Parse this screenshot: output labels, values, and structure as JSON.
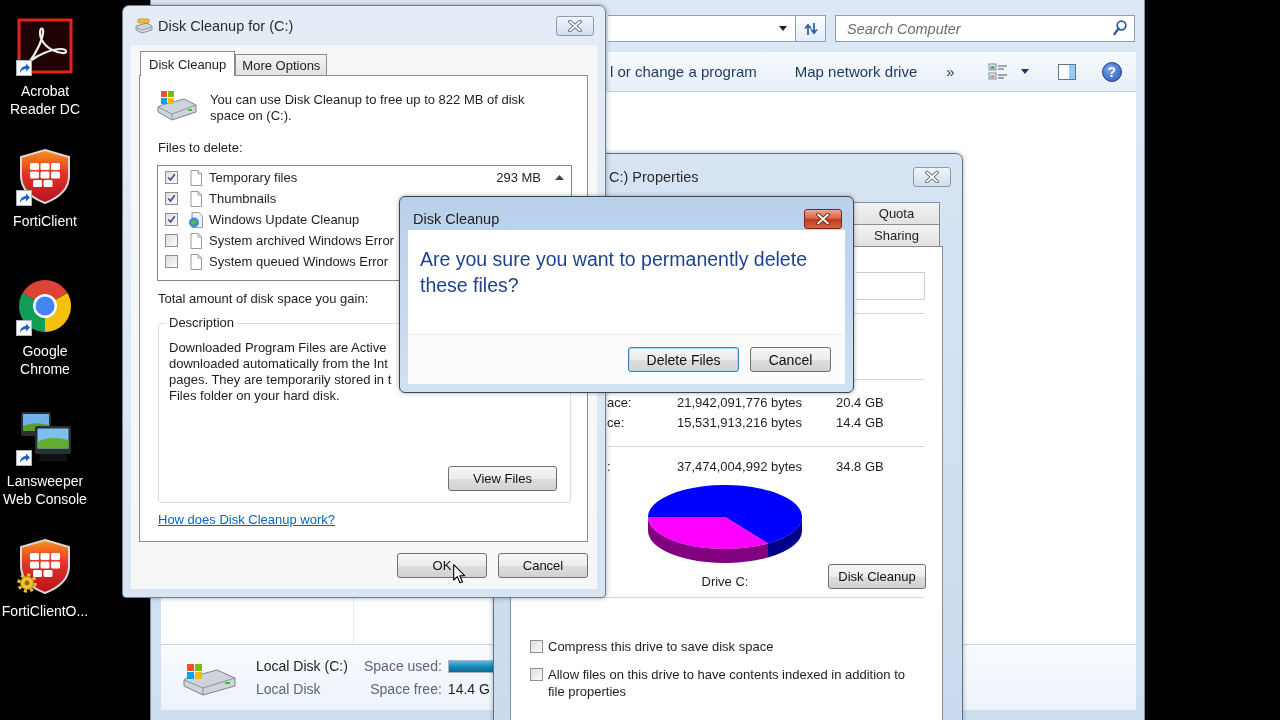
{
  "desktop_icons": [
    {
      "label": "Acrobat Reader DC",
      "kind": "pdf",
      "shortcut": true
    },
    {
      "label": "FortiClient",
      "kind": "shield",
      "shortcut": true
    },
    {
      "label": "Google Chrome",
      "kind": "browser",
      "shortcut": true
    },
    {
      "label": "Lansweeper Web Console",
      "kind": "monitors",
      "shortcut": true
    },
    {
      "label": "FortiClientO...",
      "kind": "shield_gear",
      "shortcut": false
    }
  ],
  "explorer": {
    "search": {
      "placeholder": "Search Computer"
    },
    "toolbar": [
      "l or change a program",
      "Map network drive"
    ],
    "more": "»",
    "help": "?",
    "details": {
      "name": "Local Disk (C:)",
      "type": "Local Disk",
      "used_label": "Space used:",
      "used_bar": {
        "level": 0.59
      },
      "free_label": "Space free:",
      "free_value": "14.4 G"
    }
  },
  "properties": {
    "title": "C:) Properties",
    "tabs": [
      {
        "label": "Quota",
        "selected": false
      },
      {
        "label": "Sharing",
        "selected": false
      }
    ],
    "rows": [
      {
        "label": "ace:",
        "bytes": "21,942,091,776 bytes",
        "size": "20.4 GB"
      },
      {
        "label": "ce:",
        "bytes": "15,531,913,216 bytes",
        "size": "14.4 GB"
      },
      {
        "label": ":",
        "bytes": "37,474,004,992 bytes",
        "size": "34.8 GB"
      }
    ],
    "drive_label": "Drive C:",
    "cleanup_button": "Disk Cleanup",
    "options": [
      {
        "label": "Compress this drive to save disk space",
        "checked": false
      },
      {
        "label": "Allow files on this drive to have contents indexed in addition to file properties",
        "checked": false
      }
    ]
  },
  "disk_cleanup": {
    "title": "Disk Cleanup for (C:)",
    "tabs": [
      {
        "label": "Disk Cleanup",
        "selected": true
      },
      {
        "label": "More Options",
        "selected": false
      }
    ],
    "intro": "You can use Disk Cleanup to free up to 822 MB of disk space on (C:).",
    "files_label": "Files to delete:",
    "files": [
      {
        "name": "Temporary files",
        "size": "293 MB",
        "checked": true,
        "kind": "file"
      },
      {
        "name": "Thumbnails",
        "checked": true,
        "kind": "file"
      },
      {
        "name": "Windows Update Cleanup",
        "checked": true,
        "kind": "update"
      },
      {
        "name": "System archived Windows Error",
        "checked": false,
        "kind": "file"
      },
      {
        "name": "System queued Windows Error",
        "checked": false,
        "kind": "file"
      }
    ],
    "total_label": "Total amount of disk space you gain:",
    "description": {
      "legend": "Description",
      "lines": [
        "Downloaded Program Files are Active",
        "downloaded automatically from the Int",
        "pages. They are temporarily stored in t",
        "Files folder on your hard disk."
      ]
    },
    "view_files_button": "View Files",
    "help_link": "How does Disk Cleanup work?",
    "ok_button": "OK",
    "cancel_button": "Cancel"
  },
  "confirm": {
    "title": "Disk Cleanup",
    "message": "Are you sure you want to permanently delete these files?",
    "delete_button": {
      "label": "Delete Files",
      "default": true
    },
    "cancel_button": {
      "label": "Cancel",
      "default": false
    }
  }
}
